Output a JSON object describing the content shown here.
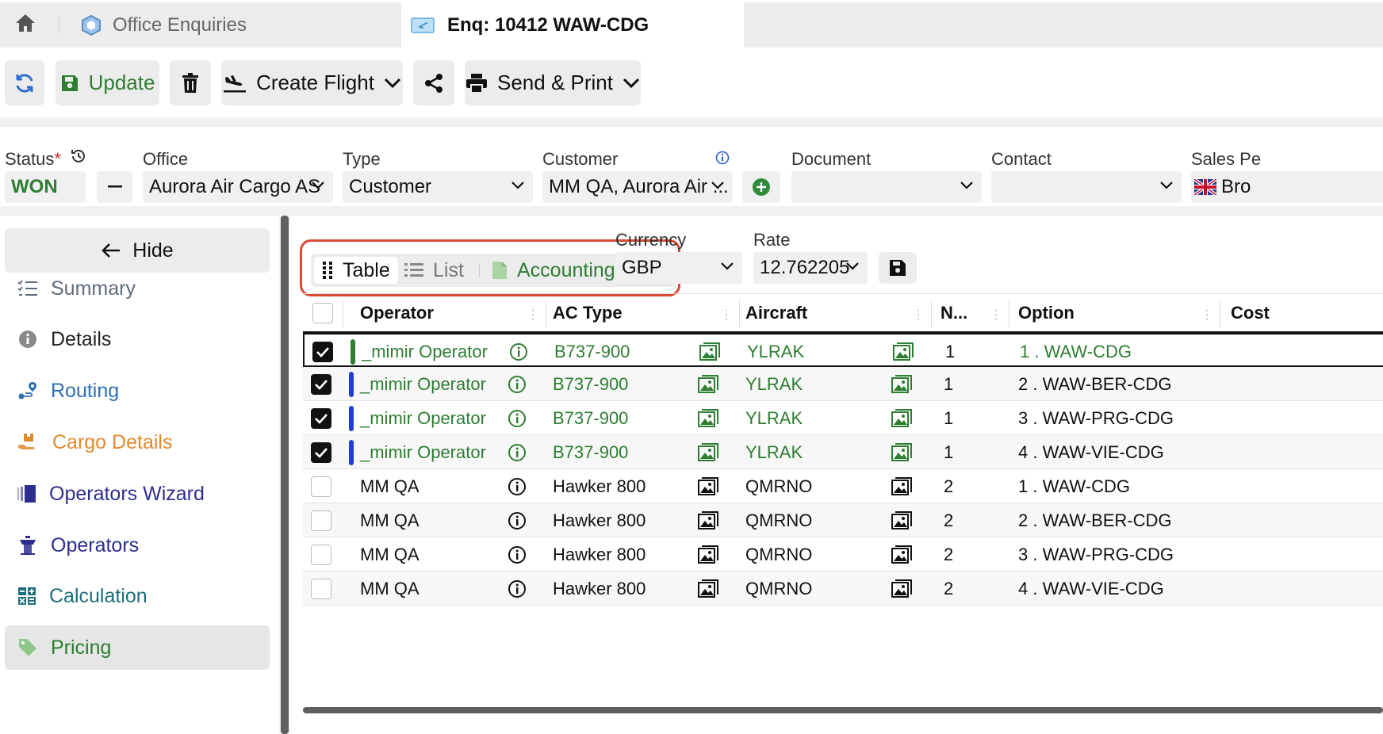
{
  "tabs": {
    "office_enquiries": "Office Enquiries",
    "enquiry": "Enq: 10412 WAW-CDG"
  },
  "toolbar": {
    "update": "Update",
    "create_flight": "Create Flight",
    "send_print": "Send & Print"
  },
  "filters": {
    "status_label": "Status",
    "status_required": "*",
    "status_value": "WON",
    "office_label": "Office",
    "office_value": "Aurora Air Cargo AS",
    "type_label": "Type",
    "type_value": "Customer",
    "customer_label": "Customer",
    "customer_value": "MM QA, Aurora Air ...",
    "document_label": "Document",
    "contact_label": "Contact",
    "sales_label": "Sales Pe",
    "sales_value": "Bro"
  },
  "sidebar": {
    "hide": "Hide",
    "items": [
      {
        "label": "Summary",
        "color": "#5f6b7a",
        "icon": "checklist-icon"
      },
      {
        "label": "Details",
        "color": "#222222",
        "icon": "info-icon"
      },
      {
        "label": "Routing",
        "color": "#2f6fb5",
        "icon": "route-icon"
      },
      {
        "label": "Cargo Details",
        "color": "#e08a2e",
        "icon": "cargo-icon"
      },
      {
        "label": "Operators Wizard",
        "color": "#2d2f8f",
        "icon": "wizard-icon"
      },
      {
        "label": "Operators",
        "color": "#2d2f8f",
        "icon": "tower-icon"
      },
      {
        "label": "Calculation",
        "color": "#1f6f7a",
        "icon": "calculator-icon"
      },
      {
        "label": "Pricing",
        "color": "#2e7d32",
        "icon": "tag-icon"
      }
    ]
  },
  "view_tabs": {
    "table": "Table",
    "list": "List",
    "accounting": "Accounting"
  },
  "currency": {
    "label": "Currency",
    "value": "GBP"
  },
  "rate": {
    "label": "Rate",
    "value": "12.762205"
  },
  "grid": {
    "columns": [
      "Operator",
      "AC Type",
      "Aircraft",
      "N...",
      "Option",
      "Cost"
    ],
    "rows": [
      {
        "checked": true,
        "bar": "#2e7d32",
        "operator": "_mimir Operator",
        "ac_type": "B737-900",
        "aircraft": "YLRAK",
        "n": "1",
        "option": "1 . WAW-CDG",
        "style": "green",
        "option_style": "green"
      },
      {
        "checked": true,
        "bar": "#1e3fd1",
        "operator": "_mimir Operator",
        "ac_type": "B737-900",
        "aircraft": "YLRAK",
        "n": "1",
        "option": "2 . WAW-BER-CDG",
        "style": "green",
        "option_style": "dark"
      },
      {
        "checked": true,
        "bar": "#1e3fd1",
        "operator": "_mimir Operator",
        "ac_type": "B737-900",
        "aircraft": "YLRAK",
        "n": "1",
        "option": "3 . WAW-PRG-CDG",
        "style": "green",
        "option_style": "dark"
      },
      {
        "checked": true,
        "bar": "#1e3fd1",
        "operator": "_mimir Operator",
        "ac_type": "B737-900",
        "aircraft": "YLRAK",
        "n": "1",
        "option": "4 . WAW-VIE-CDG",
        "style": "green",
        "option_style": "dark"
      },
      {
        "checked": false,
        "bar": "",
        "operator": "MM QA",
        "ac_type": "Hawker 800",
        "aircraft": "QMRNO",
        "n": "2",
        "option": "1 . WAW-CDG",
        "style": "dark",
        "option_style": "dark"
      },
      {
        "checked": false,
        "bar": "",
        "operator": "MM QA",
        "ac_type": "Hawker 800",
        "aircraft": "QMRNO",
        "n": "2",
        "option": "2 . WAW-BER-CDG",
        "style": "dark",
        "option_style": "dark"
      },
      {
        "checked": false,
        "bar": "",
        "operator": "MM QA",
        "ac_type": "Hawker 800",
        "aircraft": "QMRNO",
        "n": "2",
        "option": "3 . WAW-PRG-CDG",
        "style": "dark",
        "option_style": "dark"
      },
      {
        "checked": false,
        "bar": "",
        "operator": "MM QA",
        "ac_type": "Hawker 800",
        "aircraft": "QMRNO",
        "n": "2",
        "option": "4 . WAW-VIE-CDG",
        "style": "dark",
        "option_style": "dark"
      }
    ]
  },
  "colors": {
    "accent_green": "#2e7d32",
    "highlight_red": "#d94a33",
    "blue_bar": "#1e3fd1"
  }
}
